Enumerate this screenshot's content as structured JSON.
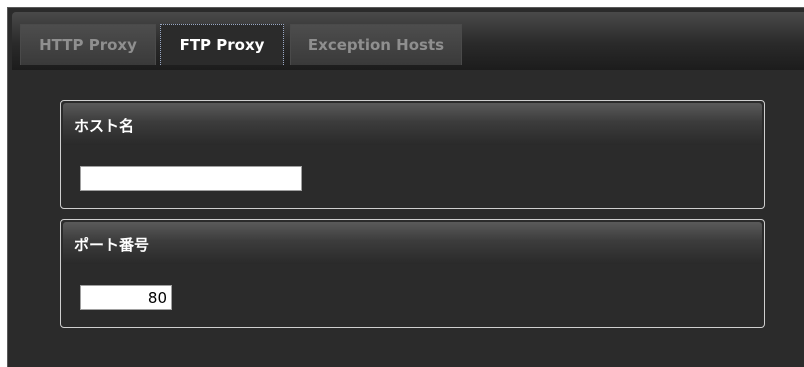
{
  "tabs": [
    {
      "label": "HTTP Proxy",
      "active": false
    },
    {
      "label": "FTP Proxy",
      "active": true
    },
    {
      "label": "Exception Hosts",
      "active": false
    }
  ],
  "host_group": {
    "title": "ホスト名",
    "value": ""
  },
  "port_group": {
    "title": "ポート番号",
    "value": "80"
  },
  "colors": {
    "background": "#2b2b2b",
    "active_tab_text": "#ffffff",
    "inactive_tab_text": "#8f8f8f",
    "group_border": "#cfcfcf"
  }
}
